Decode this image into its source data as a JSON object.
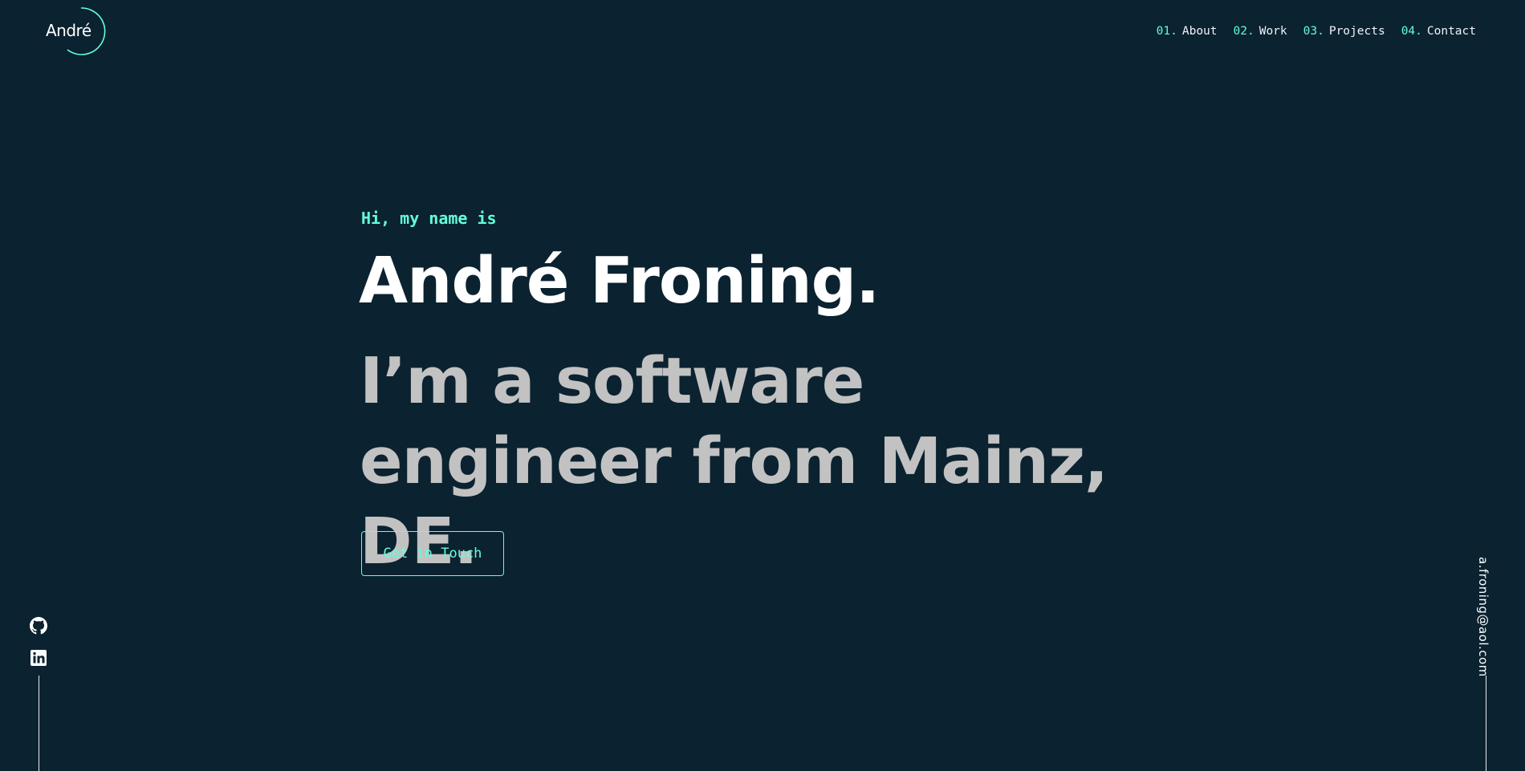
{
  "logo": {
    "text": "André"
  },
  "nav": {
    "items": [
      {
        "number": "01.",
        "label": "About"
      },
      {
        "number": "02.",
        "label": "Work"
      },
      {
        "number": "03.",
        "label": "Projects"
      },
      {
        "number": "04.",
        "label": "Contact"
      }
    ]
  },
  "hero": {
    "greeting": "Hi, my name is",
    "name": "André Froning.",
    "tagline": "I’m a software engineer from Mainz, DE.",
    "cta_label": "Get in Touch"
  },
  "socials": {
    "items": [
      {
        "icon": "github-icon"
      },
      {
        "icon": "linkedin-icon"
      }
    ]
  },
  "email": "a.froning@aol.com",
  "colors": {
    "background": "#0b2230",
    "accent": "#64ffda",
    "heading": "#ffffff",
    "tagline": "#c2c2c2"
  }
}
